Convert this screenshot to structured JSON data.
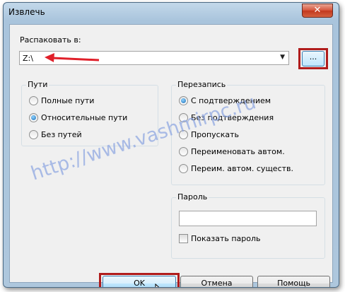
{
  "window": {
    "title": "Извлечь",
    "close_glyph": "✕"
  },
  "extract_to": {
    "label": "Распаковать в:",
    "value": "Z:\\",
    "dropdown_glyph": "▼",
    "browse_label": "..."
  },
  "paths_group": {
    "title": "Пути",
    "options": [
      {
        "label": "Полные пути",
        "checked": false
      },
      {
        "label": "Относительные пути",
        "checked": true
      },
      {
        "label": "Без путей",
        "checked": false
      }
    ]
  },
  "overwrite_group": {
    "title": "Перезапись",
    "options": [
      {
        "label": "С подтверждением",
        "checked": true
      },
      {
        "label": "Без подтверждения",
        "checked": false
      },
      {
        "label": "Пропускать",
        "checked": false
      },
      {
        "label": "Переименовать автом.",
        "checked": false
      },
      {
        "label": "Переим. автом. существ.",
        "checked": false
      }
    ]
  },
  "password_group": {
    "title": "Пароль",
    "value": "",
    "show_password_label": "Показать пароль",
    "show_password_checked": false
  },
  "buttons": {
    "ok": "OK",
    "cancel": "Отмена",
    "help": "Помощь"
  },
  "watermark": "http://www.vashmirpc.ru",
  "colors": {
    "highlight": "#b01c1c",
    "arrow": "#e0202a",
    "title_bg": "#b9d1e6"
  }
}
